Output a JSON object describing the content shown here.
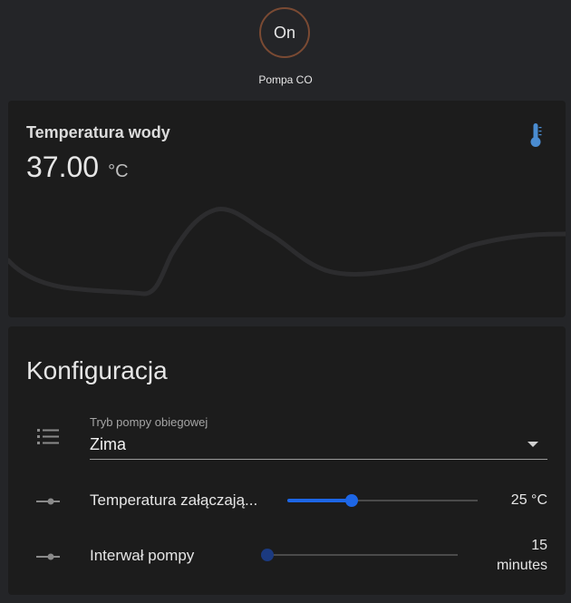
{
  "header": {
    "toggle_label": "On",
    "toggle_name": "Pompa CO"
  },
  "temperature_card": {
    "title": "Temperatura wody",
    "value": "37.00",
    "unit": "°C",
    "icon": "thermometer-icon",
    "accent_color": "#4a8cd1"
  },
  "config": {
    "title": "Konfiguracja",
    "mode_select": {
      "icon": "list-icon",
      "label": "Tryb pompy obiegowej",
      "value": "Zima"
    },
    "sliders": [
      {
        "icon": "slider-icon",
        "label": "Temperatura załączają...",
        "value_text": "25 °C",
        "fraction": 0.34
      },
      {
        "icon": "slider-icon",
        "label": "Interwał pompy",
        "value_number": "15",
        "value_unit": "minutes",
        "fraction": 0.0
      }
    ],
    "accent_color": "#1d66e6"
  }
}
